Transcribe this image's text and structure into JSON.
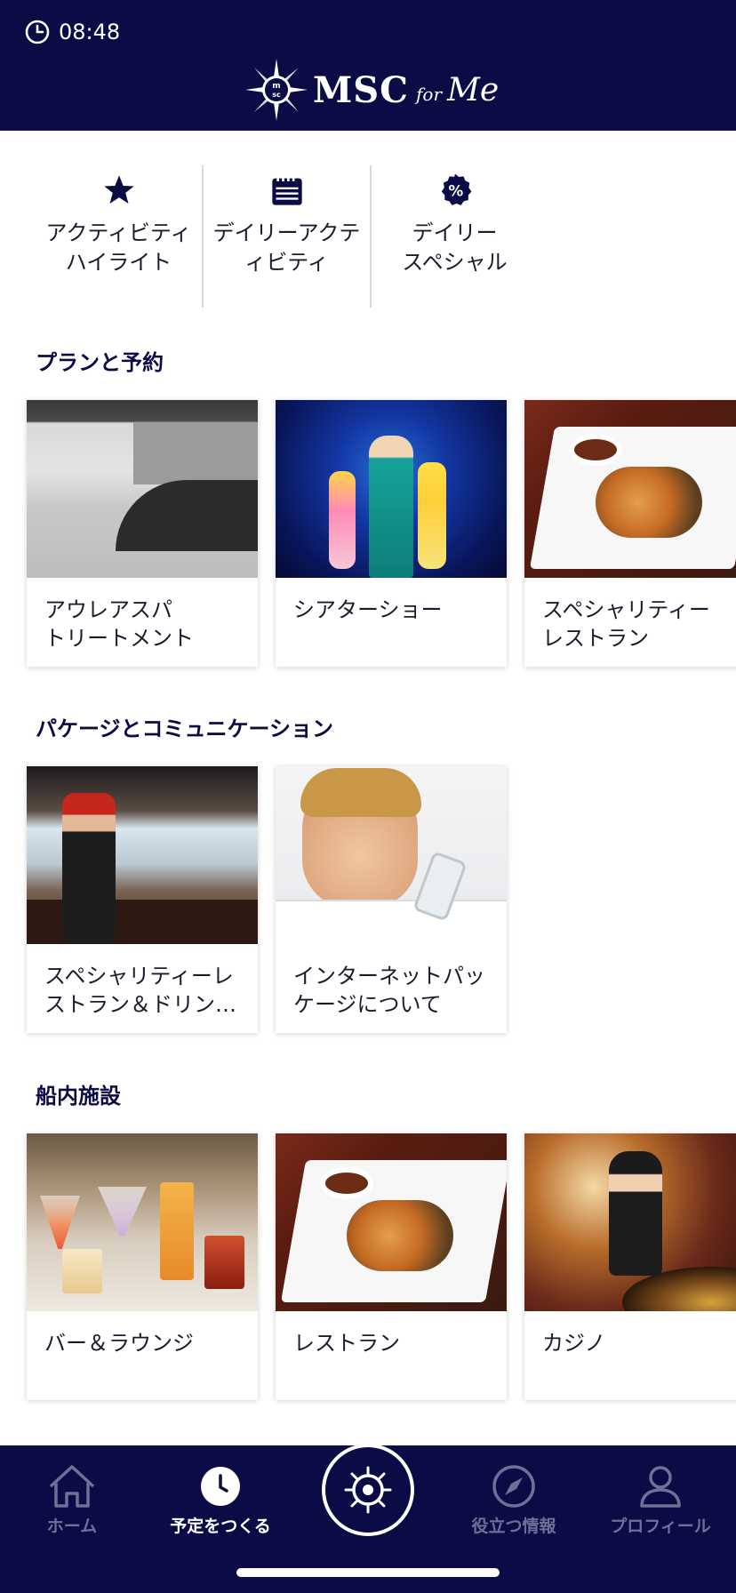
{
  "status": {
    "time": "08:48"
  },
  "brand": {
    "name": "MSC",
    "script_small": "for",
    "script": "Me"
  },
  "quick_actions": [
    {
      "label_line1": "アクティビティ",
      "label_line2": "ハイライト",
      "icon": "star-icon"
    },
    {
      "label_line1": "デイリーアクテ",
      "label_line2": "ィビティ",
      "icon": "calendar-icon"
    },
    {
      "label_line1": "デイリー",
      "label_line2": "スペシャル",
      "icon": "percent-badge-icon"
    }
  ],
  "sections": [
    {
      "title": "プランと予約",
      "cards": [
        {
          "line1": "アウレアスパ",
          "line2": "トリートメント",
          "image": "spa-reception"
        },
        {
          "line1": "シアターショー",
          "line2": "",
          "image": "theater-show"
        },
        {
          "line1": "スペシャリティー",
          "line2": "レストラン",
          "image": "tempura-plate"
        }
      ]
    },
    {
      "title": "パケージとコミュニケーション",
      "cards": [
        {
          "line1": "スペシャリティーレ",
          "line2": "ストラン＆ドリン…",
          "image": "teppanyaki-chef"
        },
        {
          "line1": "インターネットパッ",
          "line2": "ケージについて",
          "image": "man-with-phone"
        }
      ]
    },
    {
      "title": "船内施設",
      "cards": [
        {
          "line1": "バー＆ラウンジ",
          "line2": "",
          "image": "cocktails"
        },
        {
          "line1": "レストラン",
          "line2": "",
          "image": "tempura-plate"
        },
        {
          "line1": "カジノ",
          "line2": "",
          "image": "casino-dealer"
        }
      ]
    }
  ],
  "bottom_nav": {
    "items": [
      {
        "label": "ホーム",
        "icon": "home-icon",
        "active": false
      },
      {
        "label": "予定をつくる",
        "icon": "clock-icon",
        "active": true
      },
      {
        "label": "役立つ情報",
        "icon": "compass-icon",
        "active": false
      },
      {
        "label": "プロフィール",
        "icon": "profile-icon",
        "active": false
      }
    ],
    "center_icon": "ship-wheel-icon"
  },
  "colors": {
    "navy": "#0b0b45",
    "inactive_nav": "#6f6f98",
    "divider": "#d7d7df"
  }
}
